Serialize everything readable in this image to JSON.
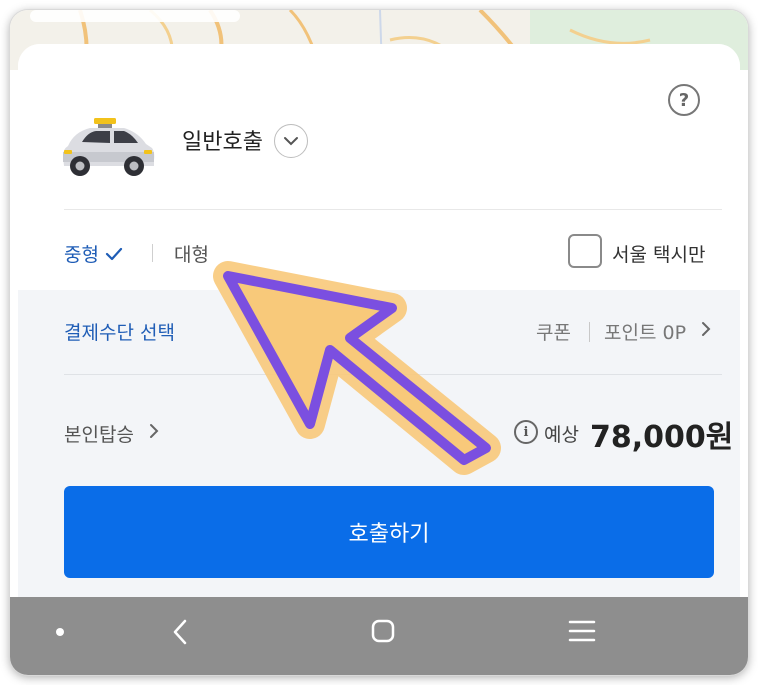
{
  "header": {
    "service_name": "일반호출",
    "help_icon": "question-circle-icon",
    "taxi_icon": "taxi-icon",
    "dropdown_icon": "chevron-down-icon"
  },
  "size_options": {
    "medium": {
      "label": "중형",
      "selected": true,
      "icon": "checkmark-icon"
    },
    "large": {
      "label": "대형",
      "selected": false
    }
  },
  "seoul_only": {
    "label": "서울 택시만",
    "checked": false
  },
  "payment": {
    "select_label": "결제수단 선택",
    "coupon_label": "쿠폰",
    "points_label": "포인트 0P"
  },
  "ride": {
    "self_ride_label": "본인탑승",
    "estimate_label": "예상",
    "price": "78,000원"
  },
  "call_button": {
    "label": "호출하기"
  },
  "colors": {
    "accent_blue": "#0a6de8",
    "link_blue": "#1f5db6",
    "arrow_fill": "#f8c97a",
    "arrow_stroke": "#7b4fe0"
  }
}
